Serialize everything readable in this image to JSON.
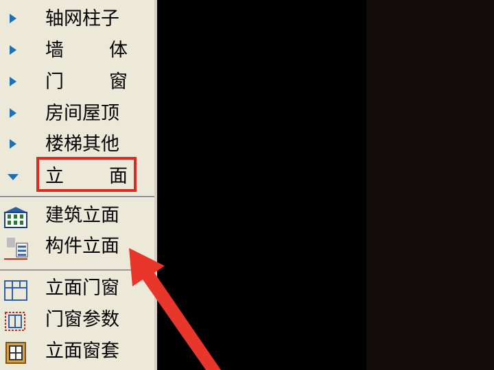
{
  "menu": {
    "categories": [
      {
        "label": "轴网柱子",
        "state": "collapsed"
      },
      {
        "label_left": "墙",
        "label_right": "体",
        "state": "collapsed"
      },
      {
        "label_left": "门",
        "label_right": "窗",
        "state": "collapsed"
      },
      {
        "label": "房间屋顶",
        "state": "collapsed"
      },
      {
        "label": "楼梯其他",
        "state": "collapsed"
      },
      {
        "label_left": "立",
        "label_right": "面",
        "state": "expanded"
      }
    ],
    "items": [
      {
        "label": "建筑立面",
        "icon": "building-elevation-icon"
      },
      {
        "label": "构件立面",
        "icon": "component-elevation-icon"
      },
      {
        "label": "立面门窗",
        "icon": "elevation-door-window-icon"
      },
      {
        "label": "门窗参数",
        "icon": "door-window-params-icon"
      },
      {
        "label": "立面窗套",
        "icon": "window-frame-icon"
      }
    ]
  },
  "colors": {
    "panel": "#ece9d8",
    "triangle": "#1f6fb5",
    "highlight": "#d92b1f",
    "canvas_dark": "#120d0a"
  }
}
